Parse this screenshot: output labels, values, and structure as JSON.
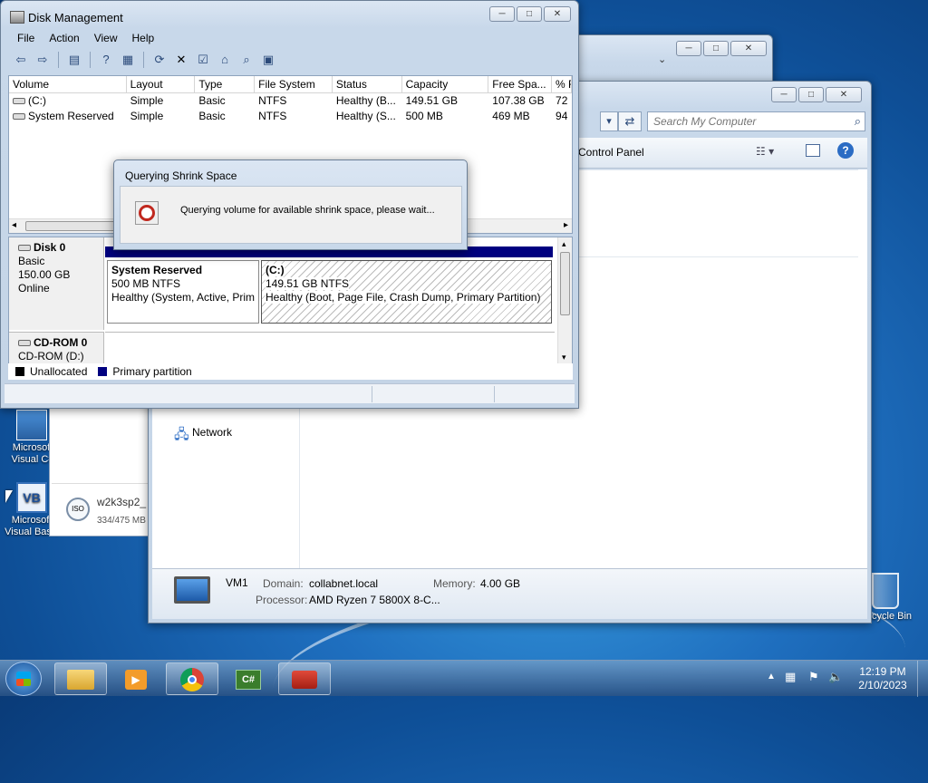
{
  "desktop": {
    "icons": [
      {
        "label": "Microsoft Visual C#"
      },
      {
        "label": "Microsoft Visual Basic"
      },
      {
        "label": "Recycle Bin"
      }
    ]
  },
  "explorer_back": {
    "download_item": {
      "name": "w2k3sp2_",
      "progress": "334/475 MB"
    }
  },
  "computer_window": {
    "search_placeholder": "Search My Computer",
    "toolbar_item": "Control Panel",
    "nav_network": "Network",
    "details": {
      "name": "VM1",
      "domain_label": "Domain:",
      "domain_value": "collabnet.local",
      "memory_label": "Memory:",
      "memory_value": "4.00 GB",
      "processor_label": "Processor:",
      "processor_value": "AMD Ryzen 7 5800X 8-C..."
    }
  },
  "disk_management": {
    "title": "Disk Management",
    "menu": [
      "File",
      "Action",
      "View",
      "Help"
    ],
    "columns": [
      "Volume",
      "Layout",
      "Type",
      "File System",
      "Status",
      "Capacity",
      "Free Spa...",
      "% F"
    ],
    "volumes": [
      {
        "volume": "(C:)",
        "layout": "Simple",
        "type": "Basic",
        "fs": "NTFS",
        "status": "Healthy (B...",
        "capacity": "149.51 GB",
        "free": "107.38 GB",
        "pct": "72"
      },
      {
        "volume": "System Reserved",
        "layout": "Simple",
        "type": "Basic",
        "fs": "NTFS",
        "status": "Healthy (S...",
        "capacity": "500 MB",
        "free": "469 MB",
        "pct": "94"
      }
    ],
    "disks": [
      {
        "name": "Disk 0",
        "type": "Basic",
        "size": "150.00 GB",
        "state": "Online"
      },
      {
        "name": "CD-ROM 0",
        "type": "CD-ROM (D:)"
      }
    ],
    "partitions": [
      {
        "name": "System Reserved",
        "size": "500 MB NTFS",
        "status": "Healthy (System, Active, Prim"
      },
      {
        "name": "(C:)",
        "size": "149.51 GB NTFS",
        "status": "Healthy (Boot, Page File, Crash Dump, Primary Partition)"
      }
    ],
    "legend": [
      {
        "label": "Unallocated",
        "color": "#000000"
      },
      {
        "label": "Primary partition",
        "color": "#000080"
      }
    ]
  },
  "dialog": {
    "title": "Querying Shrink Space",
    "message": "Querying volume for available shrink space, please wait..."
  },
  "tray": {
    "time": "12:19 PM",
    "date": "2/10/2023"
  }
}
